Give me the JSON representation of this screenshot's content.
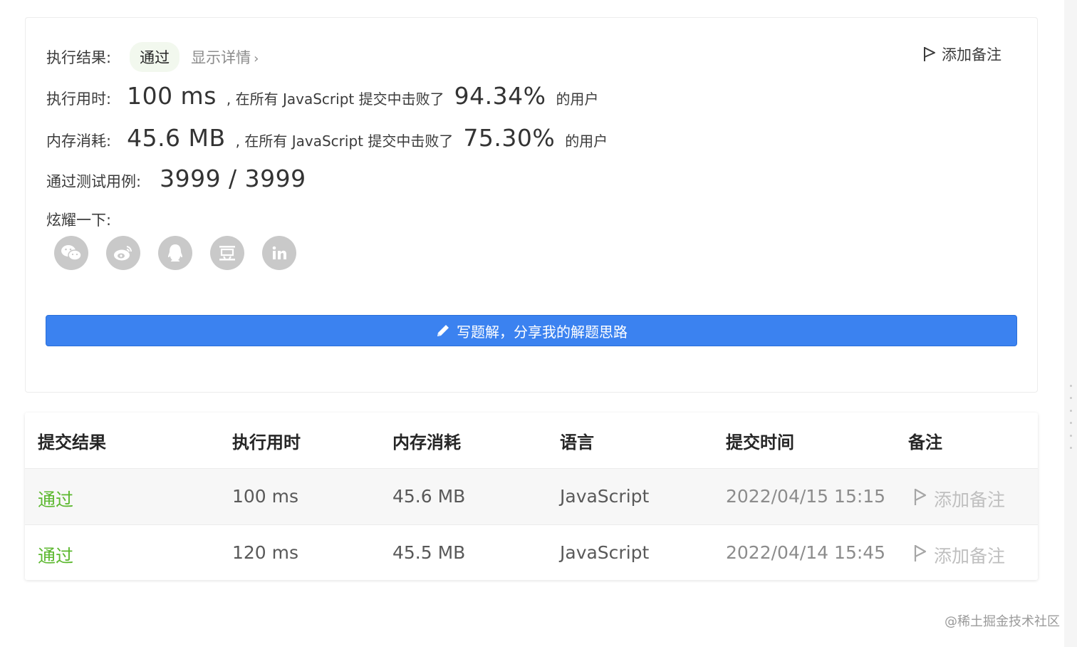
{
  "result": {
    "status_label": "执行结果:",
    "status_badge": "通过",
    "details_link": "显示详情",
    "details_chevron": "›",
    "add_note": "添加备注",
    "runtime": {
      "label": "执行用时:",
      "value": "100 ms",
      "mid_text": ", 在所有 JavaScript 提交中击败了",
      "percent": "94.34%",
      "suffix": "的用户"
    },
    "memory": {
      "label": "内存消耗:",
      "value": "45.6 MB",
      "mid_text": ", 在所有 JavaScript 提交中击败了",
      "percent": "75.30%",
      "suffix": "的用户"
    },
    "testcases": {
      "label": "通过测试用例:",
      "value": "3999 / 3999"
    },
    "share_label": "炫耀一下:",
    "share_icons": [
      "wechat-icon",
      "weibo-icon",
      "qq-icon",
      "douban-icon",
      "linkedin-icon"
    ],
    "write_button": "写题解，分享我的解题思路"
  },
  "table": {
    "headers": [
      "提交结果",
      "执行用时",
      "内存消耗",
      "语言",
      "提交时间",
      "备注"
    ],
    "rows": [
      {
        "status": "通过",
        "runtime": "100 ms",
        "memory": "45.6 MB",
        "language": "JavaScript",
        "time": "2022/04/15 15:15",
        "note": "添加备注"
      },
      {
        "status": "通过",
        "runtime": "120 ms",
        "memory": "45.5 MB",
        "language": "JavaScript",
        "time": "2022/04/14 15:45",
        "note": "添加备注"
      }
    ]
  },
  "watermark": "@稀土掘金技术社区",
  "colors": {
    "accent_blue": "#3b82f0",
    "success_green": "#5cb82f",
    "badge_bg": "#f2f8ee"
  }
}
